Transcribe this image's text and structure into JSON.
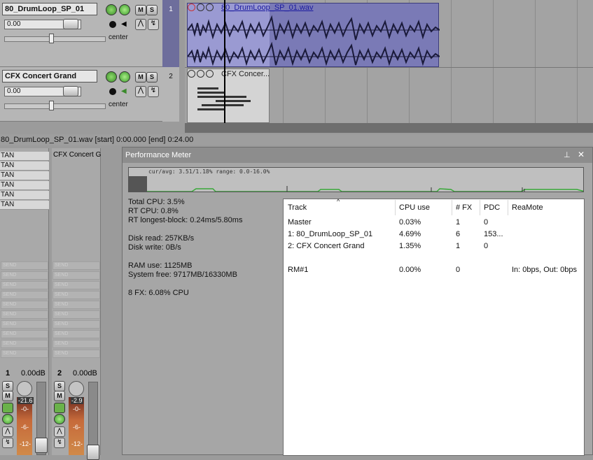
{
  "tracks": [
    {
      "number": "1",
      "name": "80_DrumLoop_SP_01",
      "volume": "0.00",
      "pan": "center",
      "item_label": "80_DrumLoop_SP_01.wav"
    },
    {
      "number": "2",
      "name": "CFX Concert Grand",
      "volume": "0.00",
      "pan": "center",
      "item_label": "CFX Concer..."
    }
  ],
  "track_buttons": {
    "mute": "M",
    "solo": "S"
  },
  "status_bar": "80_DrumLoop_SP_01.wav [start] 0:00.000 [end] 0:24.00",
  "mixer": {
    "strips": [
      {
        "label": "",
        "fx": [
          "TAN",
          "TAN",
          "TAN",
          "TAN",
          "TAN",
          "TAN"
        ],
        "number": "1",
        "db": "0.00dB",
        "meter": "-21.6"
      },
      {
        "label": "CFX Concert Gr",
        "fx": [],
        "number": "2",
        "db": "0.00dB",
        "meter": "-2.9"
      }
    ],
    "send_label": "SEND",
    "fader_marks": [
      "-0-",
      "-6-",
      "-12-"
    ],
    "solo": "S",
    "mute": "M"
  },
  "performance_meter": {
    "title": "Performance Meter",
    "graph_caption": "cur/avg: 3.51/1.18%  range: 0.0-16.0%",
    "stats": [
      "Total CPU: 3.5%",
      "RT CPU: 0.8%",
      "RT longest-block: 0.24ms/5.80ms",
      "",
      "Disk read: 257KB/s",
      "Disk write: 0B/s",
      "",
      "RAM use: 1125MB",
      "System free: 9717MB/16330MB",
      "",
      "8 FX: 6.08% CPU"
    ],
    "columns": [
      "Track",
      "CPU use",
      "# FX",
      "PDC",
      "ReaMote"
    ],
    "rows": [
      {
        "track": "Master",
        "cpu": "0.03%",
        "fx": "1",
        "pdc": "0",
        "reamote": ""
      },
      {
        "track": "1: 80_DrumLoop_SP_01",
        "cpu": "4.69%",
        "fx": "6",
        "pdc": "153...",
        "reamote": ""
      },
      {
        "track": "2: CFX Concert Grand",
        "cpu": "1.35%",
        "fx": "1",
        "pdc": "0",
        "reamote": ""
      },
      {
        "track": "RM#1",
        "cpu": "0.00%",
        "fx": "0",
        "pdc": "",
        "reamote": "In: 0bps, Out: 0bps"
      }
    ]
  },
  "colors": {
    "item_blue": "#7a7ab6",
    "item_selected": "#9a9ad2",
    "meter_green": "#38a838",
    "fx_active": "#6ab24a"
  }
}
